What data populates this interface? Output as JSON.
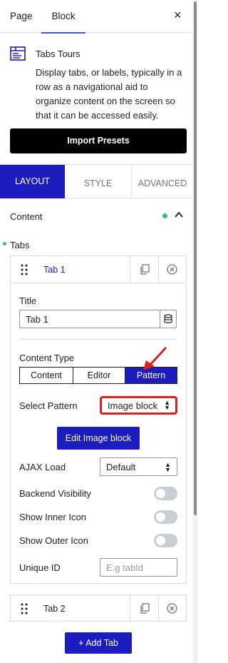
{
  "sidebar_tabs": {
    "page": "Page",
    "block": "Block",
    "close": "×"
  },
  "block_card": {
    "title": "Tabs Tours",
    "description": "Display tabs, or labels, typically in a row as a navigational aid to organize content on the screen so that it can be accessed easily."
  },
  "import_button": "Import Presets",
  "setting_tabs": {
    "layout": "LAYOUT",
    "style": "STYLE",
    "advanced": "ADVANCED"
  },
  "content_panel": {
    "title": "Content",
    "chevron": "^"
  },
  "tabs_section": {
    "label": "Tabs"
  },
  "tab1": {
    "header_title": "Tab 1",
    "title_label": "Title",
    "title_value": "Tab 1",
    "content_type_label": "Content Type",
    "content_type_options": [
      "Content",
      "Editor",
      "Pattern"
    ],
    "content_type_selected": "Pattern",
    "select_pattern_label": "Select Pattern",
    "select_pattern_value": "Image block",
    "edit_button": "Edit Image block",
    "ajax_label": "AJAX Load",
    "ajax_value": "Default",
    "backend_visibility_label": "Backend Visibility",
    "show_inner_icon_label": "Show Inner Icon",
    "show_outer_icon_label": "Show Outer Icon",
    "toggles": {
      "backend_visibility": false,
      "show_inner_icon": false,
      "show_outer_icon": false
    },
    "unique_id_label": "Unique ID",
    "unique_id_placeholder": "E.g tabId"
  },
  "tab2": {
    "header_title": "Tab 2"
  },
  "add_tab_button": "+ Add Tab",
  "colors": {
    "accent": "#1c1cbf",
    "highlight": "#e0201f",
    "status_dot": "#2ec27e"
  }
}
